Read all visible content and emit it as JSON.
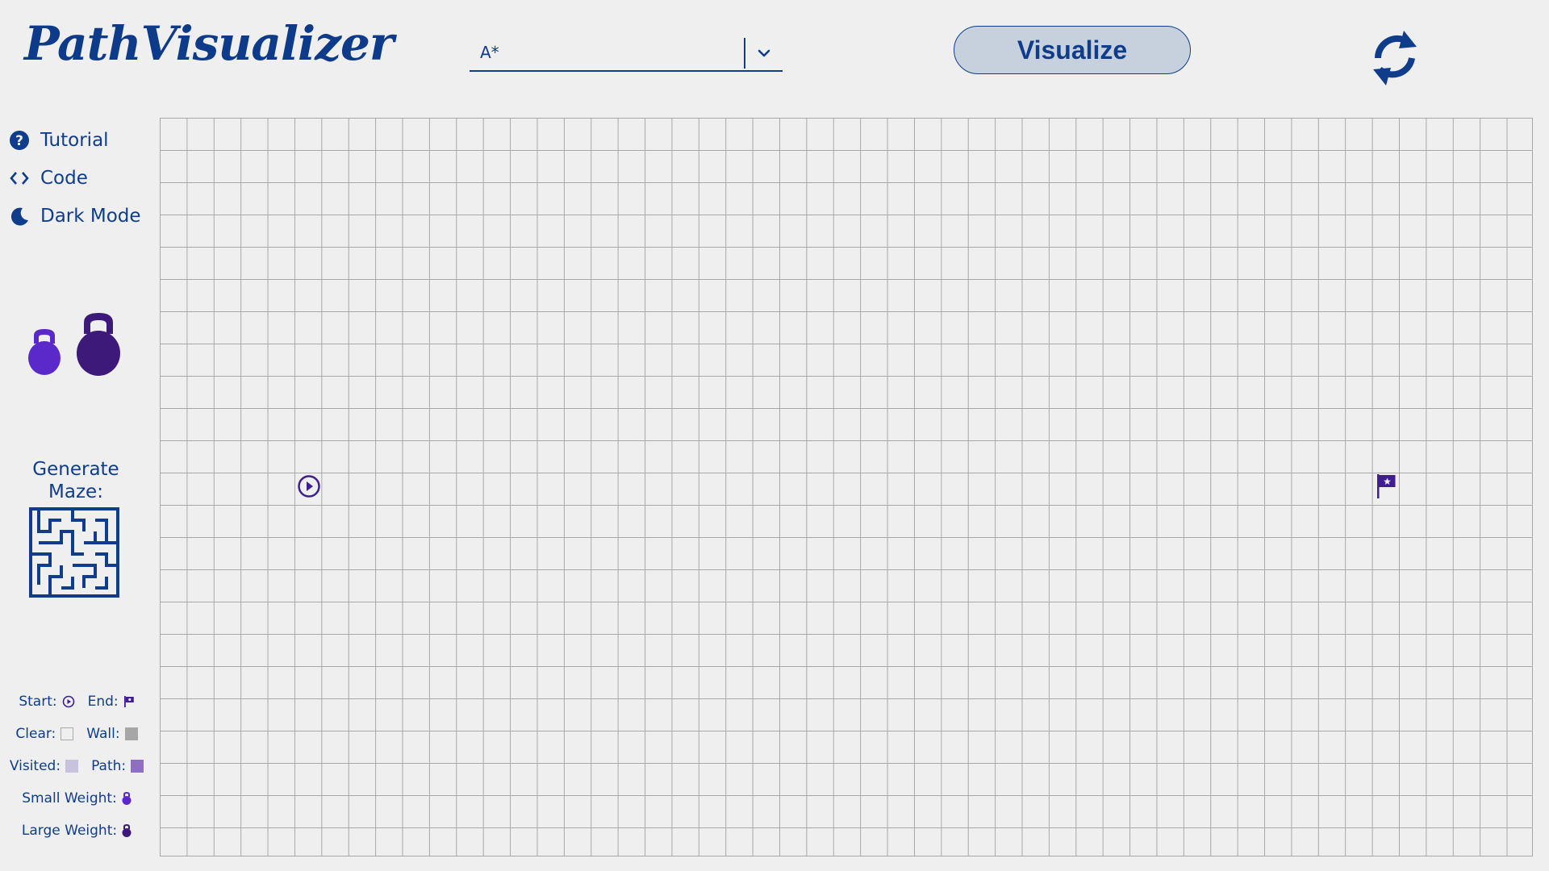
{
  "header": {
    "logo": "PathVisualizer",
    "algorithm": {
      "selected": "A*"
    },
    "visualize_label": "Visualize"
  },
  "sidebar": {
    "items": [
      {
        "label": "Tutorial",
        "icon": "question-circle-icon"
      },
      {
        "label": "Code",
        "icon": "code-brackets-icon"
      },
      {
        "label": "Dark Mode",
        "icon": "moon-icon"
      }
    ],
    "maze_label": "Generate Maze:"
  },
  "legend": {
    "start": "Start:",
    "end": "End:",
    "clear": "Clear:",
    "wall": "Wall:",
    "visited": "Visited:",
    "path": "Path:",
    "small_weight": "Small Weight:",
    "large_weight": "Large Weight:"
  },
  "colors": {
    "primary": "#0f3d8c",
    "background": "#efefef",
    "button_fill": "#c7d1dd",
    "grid_line": "#a8a8a8",
    "wall": "#a6a6a6",
    "visited": "#c9c2de",
    "path": "#8e6fc4",
    "small_weight": "#5b28c9",
    "large_weight": "#3d1a7a",
    "node_accent": "#3f1e91"
  }
}
